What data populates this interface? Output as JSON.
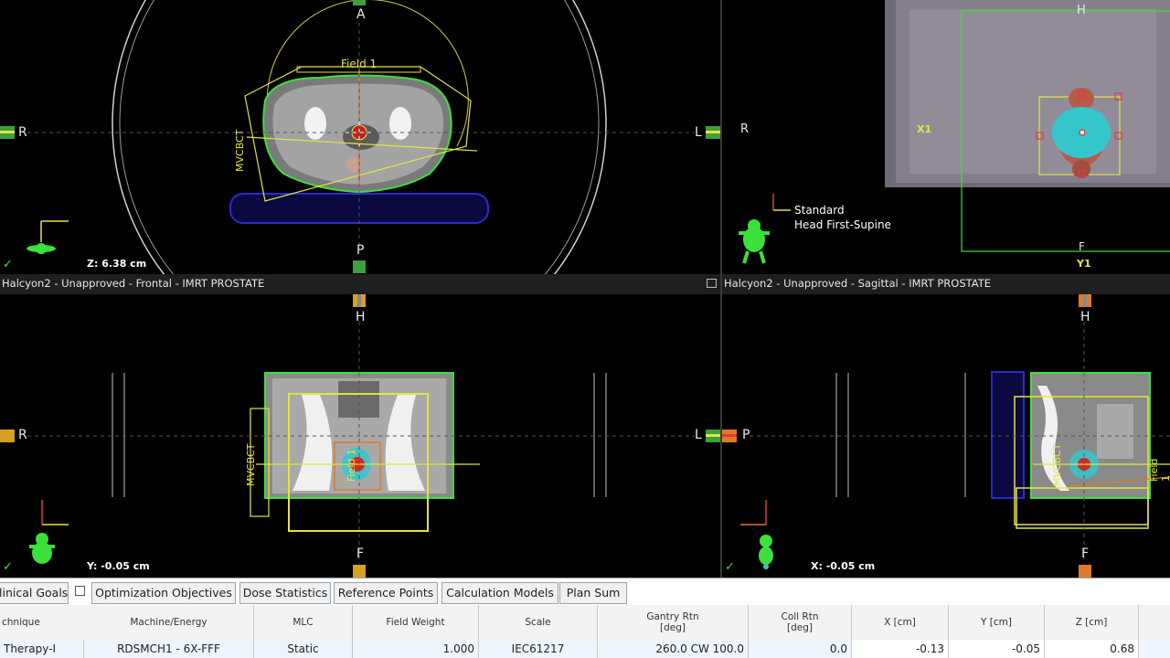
{
  "top_left": {
    "labels": {
      "top": "A",
      "bottom": "P",
      "left": "R",
      "right": "L",
      "field": "Field 1",
      "mvcbct": "MVCBCT"
    },
    "coord": "Z: 6.38 cm",
    "check": "✓"
  },
  "top_right": {
    "labels": {
      "top": "H",
      "bottom": "F",
      "left": "R",
      "x1": "X1",
      "y1": "Y1"
    },
    "orientation_line1": "Standard",
    "orientation_line2": "Head First-Supine",
    "check": "✓"
  },
  "bottom_left": {
    "title": "Halcyon2  -  Unapproved - Frontal - IMRT PROSTATE",
    "labels": {
      "top": "H",
      "bottom": "F",
      "left": "R",
      "right": "L",
      "field": "Field 1",
      "mvcbct": "MVCBCT"
    },
    "coord": "Y: -0.05 cm",
    "check": "✓"
  },
  "bottom_right": {
    "title": "Halcyon2  -  Unapproved - Sagittal - IMRT PROSTATE",
    "labels": {
      "top": "H",
      "bottom": "F",
      "left": "P",
      "field": "Field 1",
      "mvcbct": "MVCBCT"
    },
    "coord": "X: -0.05 cm",
    "check": "✓"
  },
  "tabs": [
    {
      "label": "linical Goals"
    },
    {
      "label": "Optimization Objectives"
    },
    {
      "label": "Dose Statistics"
    },
    {
      "label": "Reference Points"
    },
    {
      "label": "Calculation Models"
    },
    {
      "label": "Plan Sum"
    }
  ],
  "table": {
    "headers": [
      {
        "line1": "chnique"
      },
      {
        "line1": "Machine/Energy"
      },
      {
        "line1": "MLC"
      },
      {
        "line1": "Field Weight"
      },
      {
        "line1": "Scale"
      },
      {
        "line1": "Gantry Rtn",
        "line2": "[deg]"
      },
      {
        "line1": "Coll Rtn",
        "line2": "[deg]"
      },
      {
        "line1": "X [cm]"
      },
      {
        "line1": "Y [cm]"
      },
      {
        "line1": "Z [cm]"
      }
    ],
    "row": {
      "technique": "Therapy-I",
      "machine": "RDSMCH1 - 6X-FFF",
      "mlc": "Static",
      "weight": "1.000",
      "scale": "IEC61217",
      "gantry": "260.0 CW 100.0",
      "coll": "0.0",
      "x": "-0.13",
      "y": "-0.05",
      "z": "0.68"
    }
  }
}
